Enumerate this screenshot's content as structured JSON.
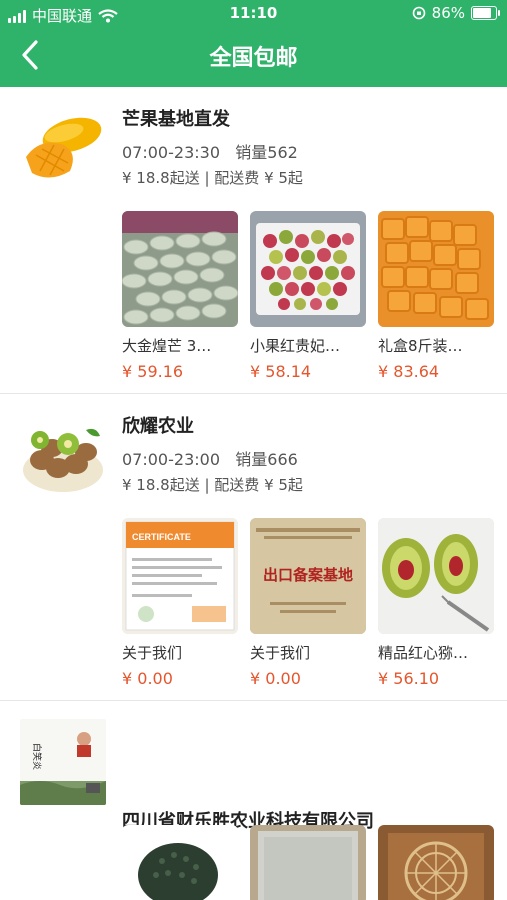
{
  "status_bar": {
    "carrier": "中国联通",
    "time": "11:10",
    "battery": "86%"
  },
  "header": {
    "title": "全国包邮",
    "back_icon": "chevron-left-icon"
  },
  "shops": [
    {
      "name": "芒果基地直发",
      "hours": "07:00-23:30",
      "sales": "销量562",
      "fee": "¥ 18.8起送 | 配送费 ¥ 5起",
      "products": [
        {
          "name": "大金煌芒  3…",
          "price": "¥ 59.16"
        },
        {
          "name": "小果红贵妃…",
          "price": "¥ 58.14"
        },
        {
          "name": "礼盒8斤装…",
          "price": "¥ 83.64"
        }
      ]
    },
    {
      "name": "欣耀农业",
      "hours": "07:00-23:00",
      "sales": "销量666",
      "fee": "¥ 18.8起送 | 配送费 ¥ 5起",
      "products": [
        {
          "name": "关于我们",
          "price": "¥ 0.00",
          "image_text": "CERTIFICATE"
        },
        {
          "name": "关于我们",
          "price": "¥ 0.00",
          "image_text": "出口备案基地"
        },
        {
          "name": "精品红心猕…",
          "price": "¥ 56.10"
        }
      ]
    },
    {
      "name": "四川省财乐胜农业科技有限公司",
      "logo_text": "白笑炎"
    }
  ]
}
